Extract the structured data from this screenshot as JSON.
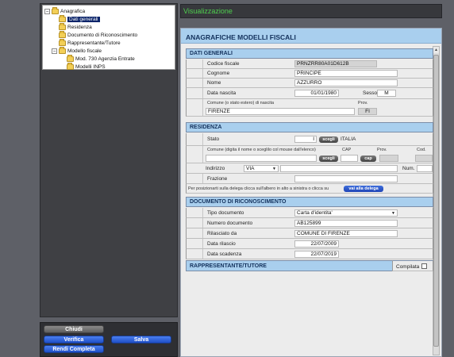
{
  "tree": {
    "items": [
      {
        "label": "Anagrafica",
        "expander": "−"
      },
      {
        "label": "Dati generali"
      },
      {
        "label": "Residenza"
      },
      {
        "label": "Documento di Riconoscimento"
      },
      {
        "label": "Rappresentante/Tutore"
      },
      {
        "label": "Modello fiscale",
        "expander": "−"
      },
      {
        "label": "Mod. 730 Agenzia Entrate"
      },
      {
        "label": "Modelli INPS"
      }
    ]
  },
  "buttons": {
    "chiudi": "Chiudi",
    "verifica": "Verifica",
    "salva": "Salva",
    "rendi": "Rendi Completa"
  },
  "viz_title": "Visualizzazione",
  "form": {
    "title": "ANAGRAFICHE MODELLI FISCALI",
    "dati_generali": {
      "section": "DATI GENERALI",
      "codice_fiscale_label": "Codice fiscale",
      "codice_fiscale": "PRNZRR80A01D612B",
      "cognome_label": "Cognome",
      "cognome": "PRINCIPE",
      "nome_label": "Nome",
      "nome": "AZZURRO",
      "data_nascita_label": "Data nascita",
      "data_nascita": "01/01/1980",
      "sesso_label": "Sesso",
      "sesso": "M",
      "comune_label": "Comune (o stato estero) di nascita",
      "comune": "FIRENZE",
      "prov_label": "Prov.",
      "prov": "FI"
    },
    "residenza": {
      "section": "RESIDENZA",
      "stato_label": "Stato",
      "stato_code": "I",
      "stato_value": "ITALIA",
      "scegli_label": "scegli",
      "comune_label": "Comune (digita il nome o sceglilo col mouse dall'elenco)",
      "cap_label": "CAP",
      "prov_label": "Prov.",
      "cod_label": "Cod.",
      "cap_btn": "cap",
      "indirizzo_label": "Indirizzo",
      "via": "VIA",
      "num_label": "Num.",
      "frazione_label": "Frazione",
      "delega_text": "Per posizionarti sulla delega clicca sull'albero in alto a sinistra o clicca su",
      "delega_btn": "vai alla delega"
    },
    "documento": {
      "section": "DOCUMENTO DI RICONOSCIMENTO",
      "tipo_label": "Tipo documento",
      "tipo": "Carta d'identita'",
      "numero_label": "Numero documento",
      "numero": "AB125899",
      "rilasciato_label": "Rilasciato da",
      "rilasciato": "COMUNE DI FIRENZE",
      "data_rilascio_label": "Data rilascio",
      "data_rilascio": "22/07/2009",
      "data_scadenza_label": "Data scadenza",
      "data_scadenza": "22/07/2019"
    },
    "rappresentante": {
      "section": "RAPPRESENTANTE/TUTORE",
      "compilata_label": "Compilata"
    }
  }
}
